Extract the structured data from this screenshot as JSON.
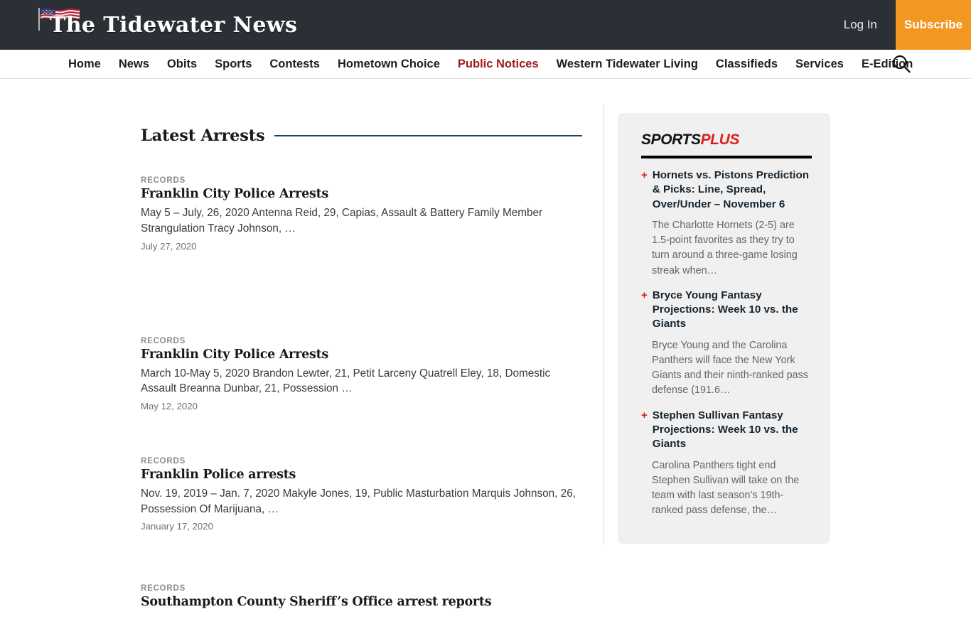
{
  "header": {
    "brand_name": "The Tidewater News",
    "flag_icon": "us-flag-icon",
    "login_label": "Log In",
    "subscribe_label": "Subscribe"
  },
  "nav": {
    "search_icon": "search-icon",
    "items": [
      {
        "label": "Home",
        "accent": false
      },
      {
        "label": "News",
        "accent": false
      },
      {
        "label": "Obits",
        "accent": false
      },
      {
        "label": "Sports",
        "accent": false
      },
      {
        "label": "Contests",
        "accent": false
      },
      {
        "label": "Hometown Choice",
        "accent": false
      },
      {
        "label": "Public Notices",
        "accent": true
      },
      {
        "label": "Western Tidewater Living",
        "accent": false
      },
      {
        "label": "Classifieds",
        "accent": false
      },
      {
        "label": "Services",
        "accent": false
      },
      {
        "label": "E-Edition",
        "accent": false
      }
    ]
  },
  "main": {
    "section_title": "Latest Arrests",
    "articles": [
      {
        "kicker": "RECORDS",
        "title": "Franklin City Police Arrests",
        "excerpt": "May 5 – July, 26, 2020 Antenna Reid, 29, Capias, Assault & Battery Family Member Strangulation Tracy Johnson, …",
        "date": "July 27, 2020"
      },
      {
        "kicker": "RECORDS",
        "title": "Franklin City Police Arrests",
        "excerpt": "March 10-May 5, 2020 Brandon Lewter, 21, Petit Larceny Quatrell Eley, 18, Domestic Assault Breanna Dunbar, 21, Possession …",
        "date": "May 12, 2020"
      },
      {
        "kicker": "RECORDS",
        "title": "Franklin Police arrests",
        "excerpt": "Nov. 19, 2019 – Jan. 7, 2020 Makyle Jones, 19, Public Masturbation Marquis Johnson, 26, Possession Of Marijuana, …",
        "date": "January 17, 2020"
      },
      {
        "kicker": "RECORDS",
        "title": "Southampton County Sheriff’s Office arrest reports",
        "excerpt": "",
        "date": ""
      }
    ]
  },
  "sidebar": {
    "widget_logo_main": "SPORTS",
    "widget_logo_accent": "PLUS",
    "bullet_glyph": "+",
    "items": [
      {
        "title": "Hornets vs. Pistons Prediction & Picks: Line, Spread, Over/Under – November 6",
        "excerpt": "The Charlotte Hornets (2-5) are 1.5-point favorites as they try to turn around a three-game losing streak when…"
      },
      {
        "title": "Bryce Young Fantasy Projections: Week 10 vs. the Giants",
        "excerpt": "Bryce Young and the Carolina Panthers will face the New York Giants and their ninth-ranked pass defense (191.6…"
      },
      {
        "title": "Stephen Sullivan Fantasy Projections: Week 10 vs. the Giants",
        "excerpt": "Carolina Panthers tight end Stephen Sullivan will take on the team with last season’s 19th-ranked pass defense, the…"
      }
    ]
  },
  "colors": {
    "header_bg": "#2b2f36",
    "subscribe_orange": "#f2971f",
    "nav_accent_red": "#a01b1b",
    "section_rule": "#17495e",
    "sidebar_bg": "#f0f0f0",
    "sports_plus_red": "#e01b1b"
  }
}
